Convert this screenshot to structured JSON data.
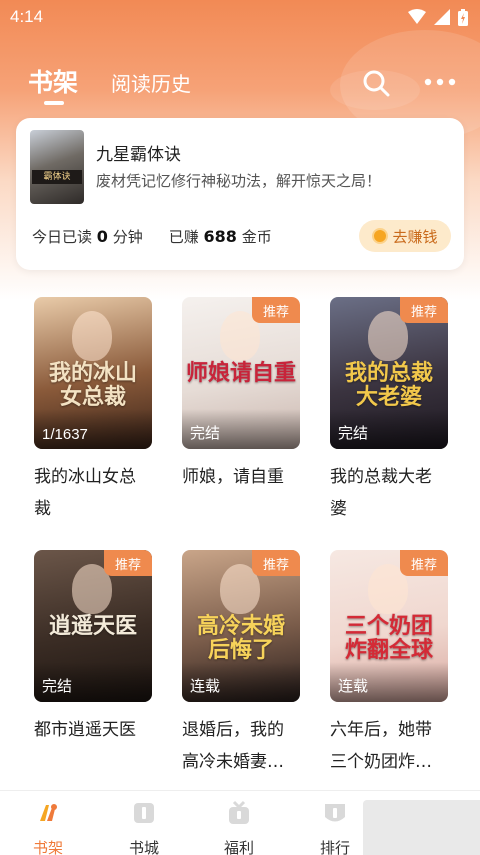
{
  "status_bar": {
    "time": "4:14"
  },
  "header": {
    "tab_shelf": "书架",
    "tab_history": "阅读历史"
  },
  "current_book": {
    "title": "九星霸体诀",
    "description": "废材凭记忆修行神秘功法，解开惊天之局！",
    "today_read_prefix": "今日已读",
    "today_read_value": "0",
    "today_read_unit": "分钟",
    "earned_prefix": "已赚",
    "earned_value": "688",
    "earned_unit": "金币",
    "cover_text": "霸体诀",
    "earn_button": "去赚钱"
  },
  "books": [
    {
      "title": "我的冰山女总\n裁",
      "status": "1/1637",
      "badge": "",
      "cover_text": "我的冰山\n女总裁",
      "colors": [
        "#e9cba9",
        "#8a5a3a",
        "#3b2419"
      ],
      "art_color": "#f3e2c3"
    },
    {
      "title": "师娘，请自重",
      "status": "完结",
      "badge": "推荐",
      "cover_text": "师娘请自重",
      "colors": [
        "#f5f1ee",
        "#e6dcd6",
        "#c9b5ad"
      ],
      "art_color": "#c8243a"
    },
    {
      "title": "我的总裁大老\n婆",
      "status": "完结",
      "badge": "推荐",
      "cover_text": "我的总裁\n大老婆",
      "colors": [
        "#6b6f86",
        "#3b3440",
        "#1d1820"
      ],
      "art_color": "#f2c84b"
    },
    {
      "title": "都市逍遥天医",
      "status": "完结",
      "badge": "推荐",
      "cover_text": "逍遥天医",
      "colors": [
        "#6b5649",
        "#3a2c24",
        "#1d1511"
      ],
      "art_color": "#f3ead9"
    },
    {
      "title": "退婚后，我的\n高冷未婚妻…",
      "status": "连载",
      "badge": "推荐",
      "cover_text": "高冷未婚\n后悔了",
      "colors": [
        "#c9a589",
        "#7a5c4a",
        "#2a1f1d"
      ],
      "art_color": "#f7d35a"
    },
    {
      "title": "六年后，她带\n三个奶团炸…",
      "status": "连载",
      "badge": "推荐",
      "cover_text": "三个奶团\n炸翻全球",
      "colors": [
        "#f6e8e2",
        "#f0d7cf",
        "#d8a9a0"
      ],
      "art_color": "#d42a36"
    }
  ],
  "bottom_nav": {
    "items": [
      {
        "label": "书架",
        "icon": "bookshelf-icon",
        "active": true
      },
      {
        "label": "书城",
        "icon": "bookstore-icon",
        "active": false
      },
      {
        "label": "福利",
        "icon": "gift-icon",
        "active": false
      },
      {
        "label": "排行",
        "icon": "ranking-icon",
        "active": false
      }
    ]
  },
  "colors": {
    "accent": "#ef7a3a",
    "badge": "#ef8a4e",
    "earn_bg": "#fdeacb"
  }
}
